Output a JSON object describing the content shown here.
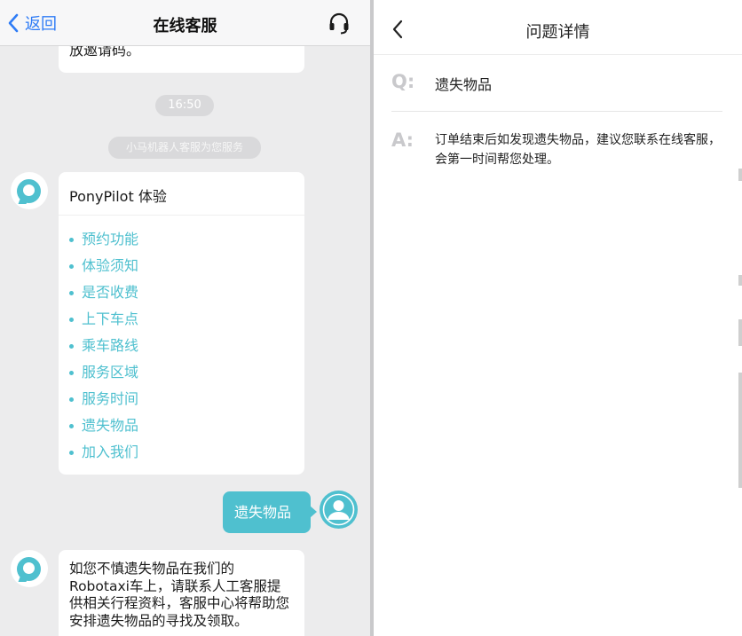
{
  "chat": {
    "back_label": "返回",
    "title": "在线客服",
    "previous_message_tail": "放邀请码。",
    "time_pill": "16:50",
    "system_notice": "小马机器人客服为您服务",
    "menu_card": {
      "title": "PonyPilot 体验",
      "items": [
        {
          "label": "预约功能"
        },
        {
          "label": "体验须知"
        },
        {
          "label": "是否收费"
        },
        {
          "label": "上下车点"
        },
        {
          "label": "乘车路线"
        },
        {
          "label": "服务区域"
        },
        {
          "label": "服务时间"
        },
        {
          "label": "遗失物品"
        },
        {
          "label": "加入我们"
        }
      ]
    },
    "user_message": "遗失物品",
    "bot_answer": "如您不慎遗失物品在我们的Robotaxi车上，请联系人工客服提供相关行程资料，客服中心将帮助您安排遗失物品的寻找及领取。"
  },
  "detail": {
    "title": "问题详情",
    "q_label": "Q:",
    "question": "遗失物品",
    "a_label": "A:",
    "answer": "订单结束后如发现遗失物品，建议您联系在线客服，会第一时间帮您处理。"
  },
  "colors": {
    "accent": "#4fc0cf",
    "link_blue": "#2f7cf6",
    "chat_bg": "#ececed",
    "pill_bg": "#d9d9db",
    "qa_label_gray": "#c9c9cc"
  },
  "icons": {
    "back": "chevron-left-icon",
    "support": "headset-icon",
    "bot_avatar": "bot-avatar-icon",
    "user_avatar": "user-avatar-icon"
  }
}
